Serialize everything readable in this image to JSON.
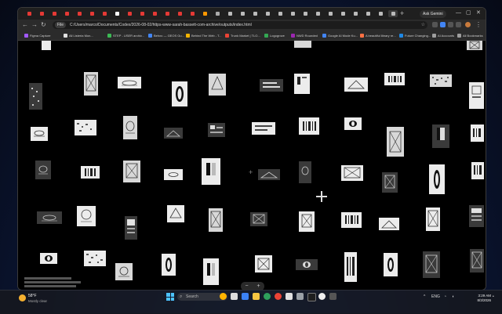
{
  "browser": {
    "ask_gemini": "Ask Gemini",
    "address": {
      "chip": "File",
      "url": "C:/Users/marco/Documents/Codex/2026-08-02/https-www-sarah-bassett-com-archive/outputs/index.html"
    },
    "bookmarks": [
      {
        "label": "Figma Capture",
        "color": "#a259ff"
      },
      {
        "label": "All Listeria Mon...",
        "color": "#e0e0e0"
      },
      {
        "label": "STEP - USER archiv...",
        "color": "#3cba54"
      },
      {
        "label": "Behov — GEOS Gu...",
        "color": "#4285f4"
      },
      {
        "label": "Behind The Web - T...",
        "color": "#f4b400"
      },
      {
        "label": "Trunk Market | TLO...",
        "color": "#ea4335"
      },
      {
        "label": "Logogrove",
        "color": "#34a853"
      },
      {
        "label": "NWD Rounded",
        "color": "#9c27b0"
      },
      {
        "label": "Google AI Mode Ku...",
        "color": "#4285f4"
      },
      {
        "label": "A beautiful library re...",
        "color": "#ff7043"
      },
      {
        "label": "Future Changing...",
        "color": "#1e88e5"
      },
      {
        "label": "AI Accounts",
        "color": "#9e9e9e"
      },
      {
        "label": "All Bookmarks",
        "color": "#9e9e9e"
      }
    ]
  },
  "zoom": {
    "minus": "−",
    "plus": "+"
  },
  "taskbar": {
    "weather": {
      "temp": "58°F",
      "condition": "Mostly clear"
    },
    "search_placeholder": "Search",
    "tray": {
      "lang": "ENG"
    },
    "clock": {
      "time": "3:29 AM",
      "date": "8/3/2026"
    }
  }
}
